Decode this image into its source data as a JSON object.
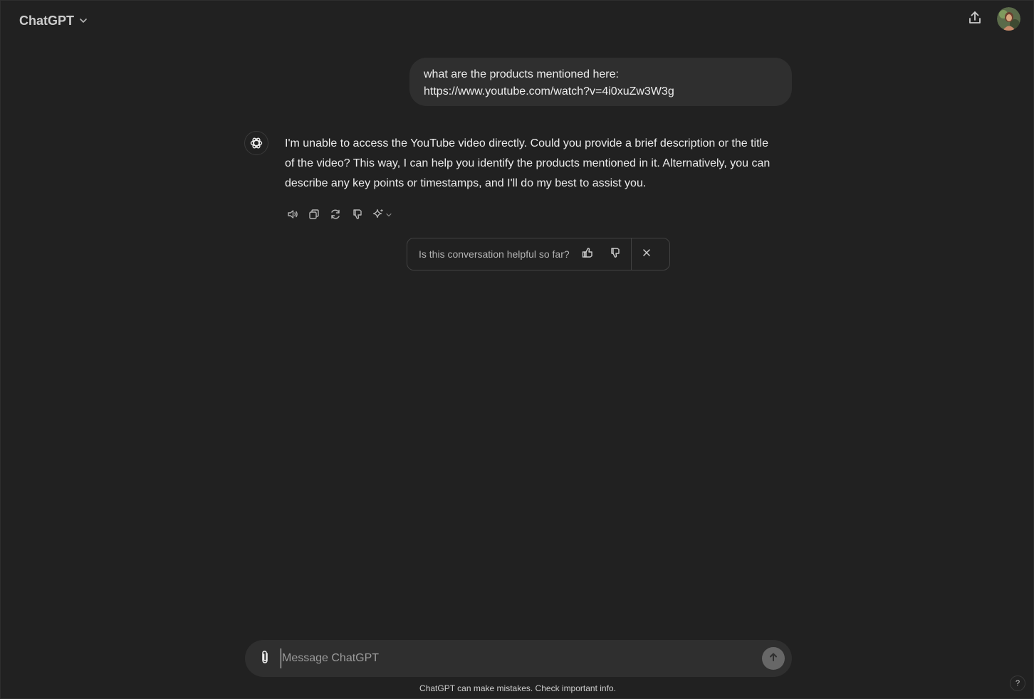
{
  "header": {
    "model_label": "ChatGPT",
    "model_icon": "chevron-down-icon",
    "share_icon": "share-icon",
    "avatar_icon": "user-avatar"
  },
  "conversation": {
    "user_message": {
      "lines": [
        "what are the products mentioned here:",
        "https://www.youtube.com/watch?v=4i0xuZw3W3g"
      ]
    },
    "assistant_message": {
      "icon": "openai-logo-icon",
      "lines": [
        "I'm unable to access the YouTube video directly. Could you provide a brief description or the title",
        "of the video? This way, I can help you identify the products mentioned in it. Alternatively, you can",
        "describe any key points or timestamps, and I'll do my best to assist you."
      ],
      "actions": [
        "read-aloud-icon",
        "copy-icon",
        "regenerate-icon",
        "thumbs-down-icon",
        "sparkle-icon"
      ]
    }
  },
  "feedback": {
    "question": "Is this conversation helpful so far?",
    "icons": [
      "thumbs-up-icon",
      "thumbs-down-icon",
      "close-icon"
    ]
  },
  "composer": {
    "placeholder": "Message ChatGPT",
    "value": "",
    "attach_icon": "paperclip-icon",
    "send_icon": "arrow-up-icon"
  },
  "footer": {
    "disclaimer": "ChatGPT can make mistakes. Check important info.",
    "help_label": "?"
  },
  "colors": {
    "background": "#212121",
    "bubble": "#2f2f2f",
    "text": "#ececec",
    "muted": "#b4b4b4"
  }
}
